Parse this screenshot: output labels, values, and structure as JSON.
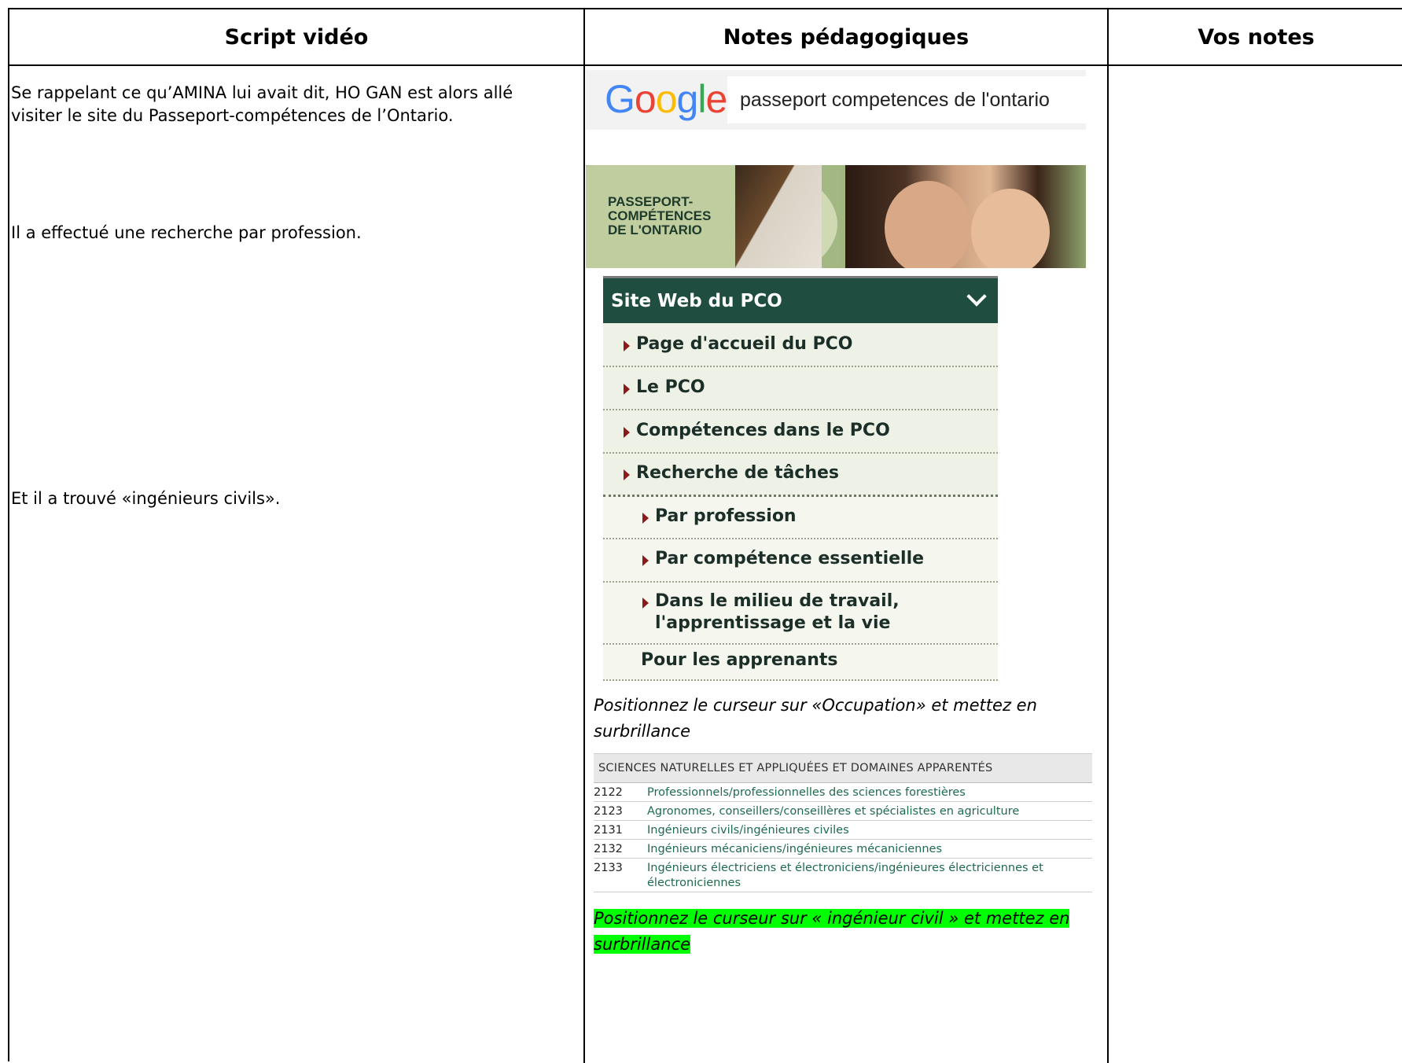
{
  "headers": {
    "script": "Script vidéo",
    "notes_ped": "Notes pédagogiques",
    "vos_notes": "Vos notes"
  },
  "script": {
    "p1_line1": "Se rappelant  ce qu’AMINA lui avait dit, HO GAN est alors allé",
    "p1_line2": "visiter le site du Passeport-compétences de l’Ontario.",
    "p2": "Il a effectué une recherche par profession.",
    "p3": "Et il a trouvé «ingénieurs civils»."
  },
  "google": {
    "logo": "Google",
    "query": "passeport competences de l'ontario"
  },
  "banner": {
    "line1": "PASSEPORT-",
    "line2": "COMPÉTENCES",
    "line3": "DE L'ONTARIO"
  },
  "menu": {
    "title": "Site Web du PCO",
    "items": [
      {
        "label": "Page d'accueil du PCO"
      },
      {
        "label": "Le PCO"
      },
      {
        "label": "Compétences dans le PCO"
      },
      {
        "label": "Recherche de tâches"
      },
      {
        "label": "Par profession"
      },
      {
        "label": "Par compétence essentielle"
      },
      {
        "label": "Dans le milieu de travail,\nl'apprentissage et la vie"
      },
      {
        "label": "Pour les apprenants"
      }
    ]
  },
  "note1_line1": "Positionnez le curseur sur «Occupation» et mettez en",
  "note1_line2": "surbrillance",
  "occupations": {
    "heading": "SCIENCES NATURELLES ET APPLIQUÉES ET DOMAINES APPARENTÉS",
    "rows": [
      {
        "code": "2122",
        "desc": "Professionnels/professionnelles des sciences forestières"
      },
      {
        "code": "2123",
        "desc": "Agronomes, conseillers/conseillères et spécialistes en agriculture"
      },
      {
        "code": "2131",
        "desc": "Ingénieurs civils/ingénieures civiles"
      },
      {
        "code": "2132",
        "desc": "Ingénieurs mécaniciens/ingénieures mécaniciennes"
      },
      {
        "code": "2133",
        "desc": "Ingénieurs électriciens et électroniciens/ingénieures électriciennes et électroniciennes"
      }
    ]
  },
  "note2_line1": "Positionnez le curseur sur « ingénieur civil » et mettez en",
  "note2_line2": "surbrillance",
  "colors": {
    "menu_head": "#1f4d3f",
    "menu_bg": "#eef2e6",
    "arrow": "#8b1a1a",
    "occ_link": "#1e6b4d",
    "highlight": "#00ff00"
  }
}
